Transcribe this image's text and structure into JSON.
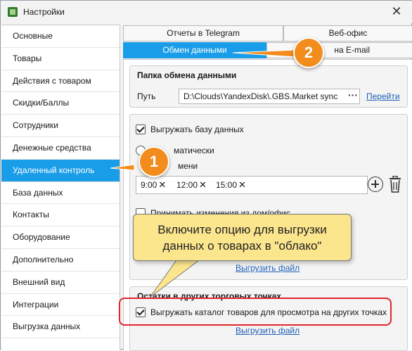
{
  "window": {
    "title": "Настройки",
    "close_icon": "close-icon"
  },
  "sidebar": {
    "items": [
      {
        "label": "Основные"
      },
      {
        "label": "Товары"
      },
      {
        "label": "Действия с товаром"
      },
      {
        "label": "Скидки/Баллы"
      },
      {
        "label": "Сотрудники"
      },
      {
        "label": "Денежные средства"
      },
      {
        "label": "Удаленный контроль",
        "active": true
      },
      {
        "label": "База данных"
      },
      {
        "label": "Контакты"
      },
      {
        "label": "Оборудование"
      },
      {
        "label": "Дополнительно"
      },
      {
        "label": "Внешний вид"
      },
      {
        "label": "Интеграции"
      },
      {
        "label": "Выгрузка данных"
      }
    ]
  },
  "tabs": {
    "telegram": "Отчеты в Telegram",
    "weboffice": "Веб-офис",
    "exchange": "Обмен данными",
    "email": "Отчеты на E-mail",
    "email_visible": "на E-mail"
  },
  "exchange_folder": {
    "title": "Папка обмена данными",
    "path_label": "Путь",
    "path_value": "D:\\Clouds\\YandexDisk\\.GBS.Market sync",
    "browse": "···",
    "open_link": "Перейти"
  },
  "upload_db": {
    "checkbox_label": "Выгружать базу данных",
    "checked": true,
    "radio_auto": "матически",
    "radio_time": "мени",
    "times": [
      "9:00",
      "12:00",
      "15:00"
    ],
    "accept_changes": "Принимать изменения из дом/офис",
    "upload_link": "Выгрузить файл"
  },
  "stock": {
    "title": "Остатки в других торговых точках",
    "checkbox_label": "Выгружать каталог товаров для просмотра на других точках",
    "checked": true,
    "upload_link": "Выгрузить файл"
  },
  "tooltip": {
    "line1": "Включите опцию для выгрузки",
    "line2": "данных о товарах в \"облако\""
  },
  "badges": {
    "one": "1",
    "two": "2"
  },
  "colors": {
    "accent": "#1a9de8",
    "badge": "#f28c1c",
    "highlight": "#e1262c",
    "tooltip": "#fbe58d"
  }
}
